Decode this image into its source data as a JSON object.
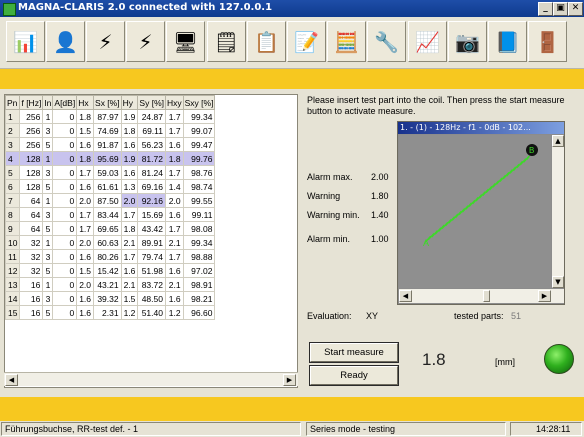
{
  "window": {
    "title": "MAGNA-CLARIS  2.0 connected with 127.0.0.1",
    "minimize_glyph": "_",
    "maximize_glyph": "▣",
    "close_glyph": "✕"
  },
  "toolbar": {
    "icons": [
      "measure-coil-icon",
      "tools-icon",
      "probe-icon",
      "probe-red-icon",
      "computer-icon",
      "blank-document-icon",
      "printer-list-icon",
      "edit-document-icon",
      "calculator-icon",
      "wrench-icon",
      "monitor-graph-icon",
      "camera-icon",
      "help-book-icon",
      "exit-door-icon"
    ],
    "glyphs": [
      "📊",
      "👤",
      "⚡",
      "⚡",
      "🖥",
      "🗒",
      "📋",
      "📝",
      "🧮",
      "🔧",
      "📈",
      "📷",
      "📘",
      "🚪"
    ]
  },
  "table": {
    "headers": [
      "Pn",
      "f [Hz]",
      "In",
      "A[dB]",
      "Hx",
      "Sx [%]",
      "Hy",
      "Sy [%]",
      "Hxy",
      "Sxy [%]"
    ],
    "rows": [
      [
        "1",
        "256",
        "1",
        "0",
        "1.8",
        "87.97",
        "1.9",
        "24.87",
        "1.7",
        "99.34"
      ],
      [
        "2",
        "256",
        "3",
        "0",
        "1.5",
        "74.69",
        "1.8",
        "69.11",
        "1.7",
        "99.07"
      ],
      [
        "3",
        "256",
        "5",
        "0",
        "1.6",
        "91.87",
        "1.6",
        "56.23",
        "1.6",
        "99.47"
      ],
      [
        "4",
        "128",
        "1",
        "0",
        "1.8",
        "95.69",
        "1.9",
        "81.72",
        "1.8",
        "99.76"
      ],
      [
        "5",
        "128",
        "3",
        "0",
        "1.7",
        "59.03",
        "1.6",
        "81.24",
        "1.7",
        "98.76"
      ],
      [
        "6",
        "128",
        "5",
        "0",
        "1.6",
        "61.61",
        "1.3",
        "69.16",
        "1.4",
        "98.74"
      ],
      [
        "7",
        "64",
        "1",
        "0",
        "2.0",
        "87.50",
        "2.0",
        "92.16",
        "2.0",
        "99.55"
      ],
      [
        "8",
        "64",
        "3",
        "0",
        "1.7",
        "83.44",
        "1.7",
        "15.69",
        "1.6",
        "99.11"
      ],
      [
        "9",
        "64",
        "5",
        "0",
        "1.7",
        "69.65",
        "1.8",
        "43.42",
        "1.7",
        "98.08"
      ],
      [
        "10",
        "32",
        "1",
        "0",
        "2.0",
        "60.63",
        "2.1",
        "89.91",
        "2.1",
        "99.34"
      ],
      [
        "11",
        "32",
        "3",
        "0",
        "1.6",
        "80.26",
        "1.7",
        "79.74",
        "1.7",
        "98.88"
      ],
      [
        "12",
        "32",
        "5",
        "0",
        "1.5",
        "15.42",
        "1.6",
        "51.98",
        "1.6",
        "97.02"
      ],
      [
        "13",
        "16",
        "1",
        "0",
        "2.0",
        "43.21",
        "2.1",
        "83.72",
        "2.1",
        "98.91"
      ],
      [
        "14",
        "16",
        "3",
        "0",
        "1.6",
        "39.32",
        "1.5",
        "48.50",
        "1.6",
        "98.21"
      ],
      [
        "15",
        "16",
        "5",
        "0",
        "1.6",
        "2.31",
        "1.2",
        "51.40",
        "1.2",
        "96.60"
      ]
    ]
  },
  "instruction": "Please insert test part into the coil. Then press the start measure button to activate measure.",
  "alarms": [
    {
      "label": "Alarm max.",
      "value": "2.00"
    },
    {
      "label": "Warning",
      "value": "1.80"
    },
    {
      "label": "Warning min.",
      "value": "1.40"
    },
    {
      "label": "Alarm min.",
      "value": "1.00"
    }
  ],
  "plot": {
    "header": "1. - (1) - 128Hz - f1 - 0dB - 102...",
    "marker_a": "A",
    "marker_b": "B",
    "trace_color": "#3ed82a"
  },
  "evaluation": {
    "label": "Evaluation:",
    "value": "XY"
  },
  "tested_parts": {
    "label": "tested parts:",
    "value": "51"
  },
  "buttons": {
    "start": "Start measure",
    "ready": "Ready"
  },
  "measurement": {
    "value": "1.8",
    "unit": "[mm]"
  },
  "status": {
    "left": "Führungsbuchse, RR-test def. - 1",
    "mode": "Series mode - testing",
    "time": "14:28:11"
  },
  "colors": {
    "accent_yellow": "#f7c81f",
    "selection": "#c8c3ee",
    "ok_led": "#2fb01e"
  }
}
